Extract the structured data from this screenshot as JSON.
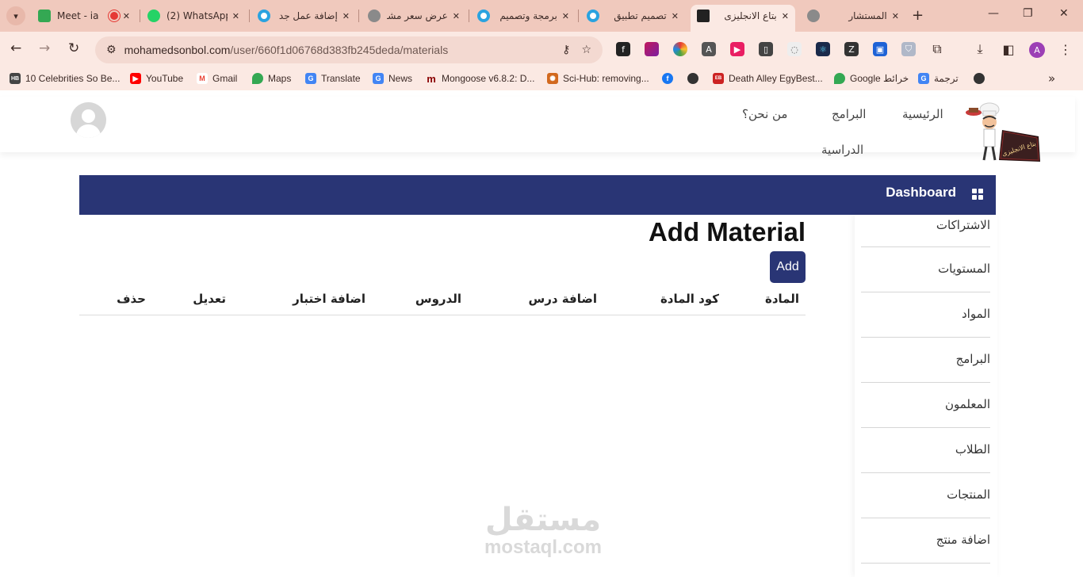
{
  "browser": {
    "tabs": [
      {
        "title": "Meet - ia",
        "favicon_color": "#34a853",
        "active": false
      },
      {
        "title": "(2) WhatsApp",
        "favicon_color": "#25d366",
        "active": false
      },
      {
        "title": "إضافة عمل جد",
        "favicon_color": "#2aa3e0",
        "active": false
      },
      {
        "title": "عرض سعر مشر",
        "favicon_color": "#8a8a8a",
        "active": false
      },
      {
        "title": "برمجة وتصميم",
        "favicon_color": "#2aa3e0",
        "active": false
      },
      {
        "title": "تصميم تطبيق",
        "favicon_color": "#2aa3e0",
        "active": false
      },
      {
        "title": "بتاع الانجليزى",
        "favicon_color": "#222222",
        "active": true
      },
      {
        "title": "المستشار",
        "favicon_color": "#8a8a8a",
        "active": false
      }
    ],
    "url_host": "mohamedsonbol.com",
    "url_path": "/user/660f1d06768d383fb245deda/materials",
    "profile_initial": "A",
    "bookmarks": [
      {
        "label": "10 Celebrities So Be...",
        "icon": "hb-icon",
        "color": "#444444"
      },
      {
        "label": "YouTube",
        "icon": "youtube-icon",
        "color": "#ff0000"
      },
      {
        "label": "Gmail",
        "icon": "gmail-icon",
        "color": "#ea4335"
      },
      {
        "label": "Maps",
        "icon": "maps-icon",
        "color": "#34a853"
      },
      {
        "label": "Translate",
        "icon": "translate-icon",
        "color": "#4285f4"
      },
      {
        "label": "News",
        "icon": "news-icon",
        "color": "#4285f4"
      },
      {
        "label": "Mongoose v6.8.2: D...",
        "icon": "mongoose-icon",
        "color": "#880000"
      },
      {
        "label": "Sci-Hub: removing...",
        "icon": "scihub-icon",
        "color": "#d2691e"
      },
      {
        "label": "",
        "icon": "facebook-icon",
        "color": "#1877f2"
      },
      {
        "label": "",
        "icon": "globe-icon",
        "color": "#333333"
      },
      {
        "label": "Death Alley EgyBest...",
        "icon": "egybest-icon",
        "color": "#cc2222"
      },
      {
        "label": "Google خرائط",
        "icon": "maps-icon",
        "color": "#34a853"
      },
      {
        "label": "ترجمة",
        "icon": "translate-icon",
        "color": "#4285f4"
      },
      {
        "label": "",
        "icon": "globe-icon",
        "color": "#333333"
      }
    ]
  },
  "site": {
    "nav": {
      "home": "الرئيسية",
      "programs": "البرامج",
      "about": "من نحن؟",
      "study": "الدراسية"
    },
    "logo_text": "بتاع الانجليزى",
    "dashboard_label": "Dashboard",
    "sidebar": [
      "الاشتراكات",
      "المستويات",
      "المواد",
      "البرامج",
      "المعلمون",
      "الطلاب",
      "المنتجات",
      "اضافة منتج"
    ],
    "page_title": "Add Material",
    "add_button": "Add",
    "table_headers": [
      "المادة",
      "كود المادة",
      "اضافة درس",
      "الدروس",
      "اضافة اختبار",
      "تعديل",
      "حذف"
    ],
    "watermark": {
      "arabic": "مستقل",
      "latin": "mostaql.com"
    }
  },
  "colors": {
    "accent_navy": "#293575",
    "chrome_tabstrip": "#f0c9bd",
    "chrome_toolbar": "#fbe9e3"
  }
}
